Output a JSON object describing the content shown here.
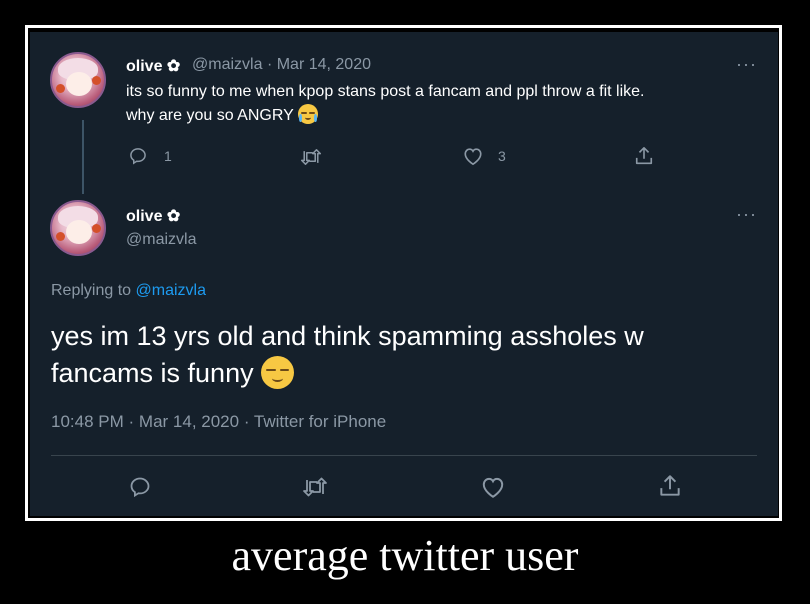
{
  "tweet1": {
    "name": "olive",
    "badge": "✿",
    "handle": "@maizvla",
    "dot": "·",
    "date": "Mar 14, 2020",
    "line1": "its so funny to me when kpop stans post a fancam and ppl throw a fit like.",
    "line2": "why are you so ANGRY",
    "emoji": "loudly-crying-face",
    "reply_count": "1",
    "like_count": "3",
    "more": "···"
  },
  "tweet2": {
    "name": "olive",
    "badge": "✿",
    "handle": "@maizvla",
    "more": "···",
    "replying_prefix": "Replying to ",
    "replying_handle": "@maizvla",
    "line1": "yes im 13 yrs old and think spamming assholes w",
    "line2": "fancams is funny",
    "emoji": "relieved-face",
    "time": "10:48 PM",
    "sep": "·",
    "date": "Mar 14, 2020",
    "sep2": "·",
    "source": "Twitter for iPhone"
  },
  "caption": "average twitter user",
  "colors": {
    "background": "#15202b",
    "text": "#ffffff",
    "muted": "#8b98a5",
    "link": "#1d9bf0",
    "divider": "#38444d"
  },
  "icons": [
    "reply-icon",
    "retweet-icon",
    "like-icon",
    "share-icon",
    "more-icon",
    "flower-badge-icon"
  ]
}
